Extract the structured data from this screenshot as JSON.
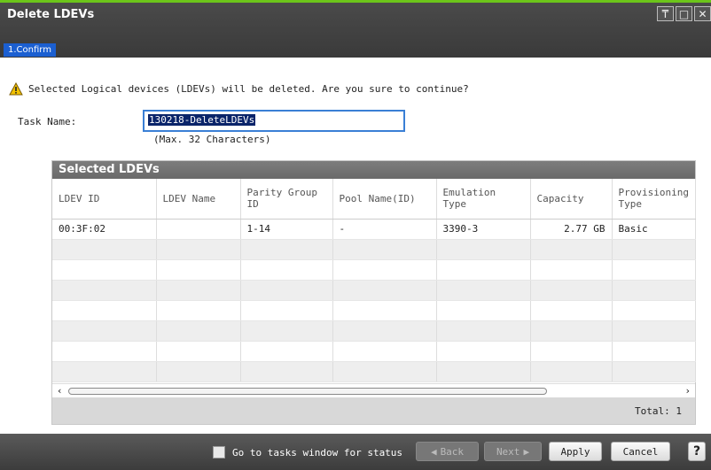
{
  "window": {
    "title": "Delete LDEVs",
    "step": "1.Confirm"
  },
  "warning": {
    "text": "Selected Logical devices (LDEVs) will be deleted. Are you sure to continue?"
  },
  "task": {
    "label": "Task Name:",
    "value": "130218-DeleteLDEVs",
    "hint": "(Max. 32 Characters)"
  },
  "panel": {
    "title": "Selected LDEVs",
    "columns": [
      "LDEV ID",
      "LDEV Name",
      "Parity Group ID",
      "Pool Name(ID)",
      "Emulation Type",
      "Capacity",
      "Provisioning Type"
    ],
    "rows": [
      [
        "00:3F:02",
        "",
        "1-14",
        "-",
        "3390-3",
        "2.77 GB",
        "Basic"
      ]
    ],
    "total": "Total:  1"
  },
  "footer": {
    "checkbox_label": "Go to tasks window for status",
    "back": "Back",
    "next": "Next",
    "apply": "Apply",
    "cancel": "Cancel",
    "help": "?"
  },
  "colors": {
    "accent": "#6cc51a",
    "selection": "#1b5fd1",
    "focus": "#3a7fd5"
  }
}
